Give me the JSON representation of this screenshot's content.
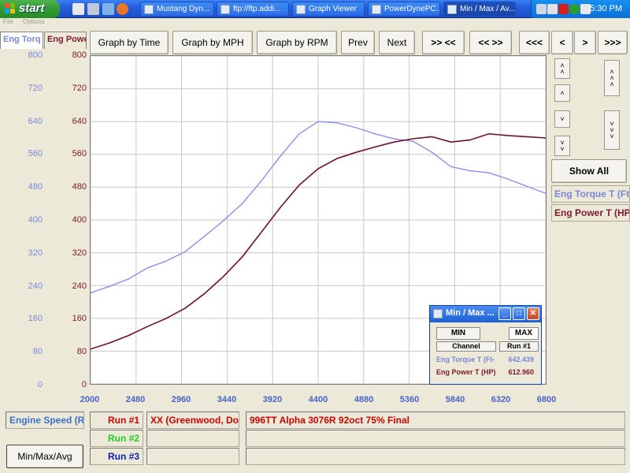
{
  "taskbar": {
    "start_label": "start",
    "tasks": [
      "Mustang Dyn...",
      "ftp://ftp.addi...",
      "Graph Viewer",
      "PowerDynePC...",
      "Min / Max / Av..."
    ],
    "clock": "5:30 PM"
  },
  "menu": [
    "File",
    "Options"
  ],
  "tabs": {
    "torque": "Eng Torq",
    "power": "Eng Powe"
  },
  "toolbar": {
    "graph_by_time": "Graph by Time",
    "graph_by_mph": "Graph by MPH",
    "graph_by_rpm": "Graph by RPM",
    "prev": "Prev",
    "next": "Next",
    "zoom_in": ">> <<",
    "zoom_out": "<< >>",
    "first": "<<<",
    "left": "<",
    "right": ">",
    "last": ">>>"
  },
  "side": {
    "show_all": "Show All",
    "legend_torque": "Eng Torque T (Ft",
    "legend_power": "Eng Power T (HP"
  },
  "axes": {
    "y_ticks": [
      "800",
      "720",
      "640",
      "560",
      "480",
      "400",
      "320",
      "240",
      "160",
      "80",
      "0"
    ],
    "x_ticks": [
      "2000",
      "2480",
      "2960",
      "3440",
      "3920",
      "4400",
      "4880",
      "5360",
      "5840",
      "6320",
      "6800"
    ]
  },
  "colors": {
    "torque": "#8a8fe6",
    "power": "#6e0f2a",
    "run1": "#cc0000",
    "run2": "#22cc22",
    "run3": "#1020b0",
    "xaxis": "#4a62c8"
  },
  "chart_data": {
    "type": "line",
    "xlabel": "",
    "ylabel": "",
    "xlim": [
      2000,
      6800
    ],
    "ylim": [
      0,
      800
    ],
    "grid": true,
    "series": [
      {
        "name": "Eng Torque T (Ft",
        "x": [
          2000,
          2200,
          2400,
          2600,
          2800,
          3000,
          3200,
          3400,
          3600,
          3800,
          4000,
          4200,
          4400,
          4600,
          4800,
          5000,
          5200,
          5400,
          5600,
          5800,
          6000,
          6200,
          6400,
          6600,
          6800
        ],
        "y": [
          222,
          238,
          256,
          283,
          300,
          323,
          360,
          398,
          440,
          495,
          555,
          610,
          640,
          637,
          625,
          610,
          598,
          592,
          565,
          530,
          520,
          515,
          500,
          482,
          465
        ]
      },
      {
        "name": "Eng Power T (HP",
        "x": [
          2000,
          2200,
          2400,
          2600,
          2800,
          3000,
          3200,
          3400,
          3600,
          3800,
          4000,
          4200,
          4400,
          4600,
          4800,
          5000,
          5200,
          5400,
          5600,
          5800,
          6000,
          6200,
          6400,
          6600,
          6800
        ],
        "y": [
          85,
          100,
          118,
          140,
          160,
          185,
          220,
          262,
          310,
          370,
          430,
          485,
          525,
          550,
          565,
          578,
          590,
          598,
          603,
          590,
          595,
          610,
          606,
          603,
          600
        ]
      }
    ]
  },
  "bottom": {
    "channel_label": "Engine Speed (Rl",
    "run1": "Run #1",
    "run2": "Run #2",
    "run3": "Run #3",
    "run1_name": "XX (Greenwood, Don",
    "run1_desc": "996TT Alpha 3076R 92oct 75% Final",
    "minmax_button": "Min/Max/Avg"
  },
  "dialog": {
    "title": "Min / Max ...",
    "min_label": "MIN",
    "max_label": "MAX",
    "channel_header": "Channel",
    "run_header": "Run #1",
    "rows": [
      {
        "name": "Eng Torque T (Ft-",
        "value": "642.439"
      },
      {
        "name": "Eng Power T (HP)",
        "value": "612.960"
      }
    ]
  }
}
